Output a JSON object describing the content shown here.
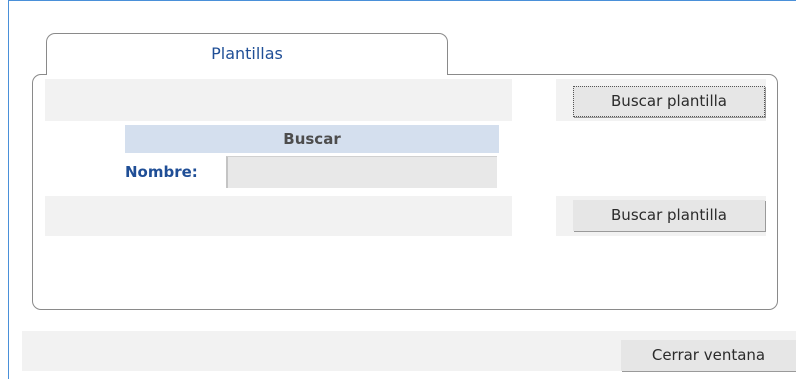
{
  "tab": {
    "label": "Plantillas"
  },
  "search": {
    "top_button_label": "Buscar plantilla",
    "header": "Buscar",
    "name_label": "Nombre:",
    "name_value": "",
    "bottom_button_label": "Buscar plantilla"
  },
  "footer": {
    "close_label": "Cerrar ventana"
  }
}
